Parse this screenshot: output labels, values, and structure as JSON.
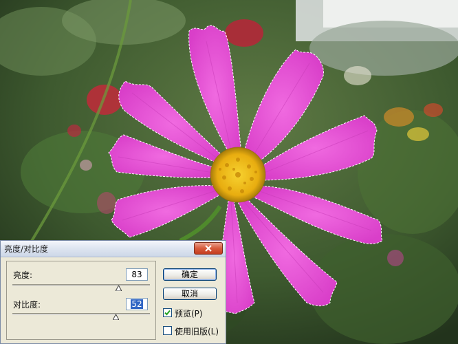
{
  "dialog": {
    "title": "亮度/对比度",
    "brightness": {
      "label": "亮度:",
      "value": "83",
      "level_percent": 75
    },
    "contrast": {
      "label": "对比度:",
      "value": "52",
      "level_percent": 73
    },
    "buttons": {
      "ok": "确定",
      "cancel": "取消"
    },
    "preview": {
      "label": "预览(P)",
      "checked": true
    },
    "legacy": {
      "label": "使用旧版(L)",
      "checked": false
    }
  },
  "icons": {
    "close": "close-icon",
    "checkmark": "checkmark-icon",
    "slider_thumb": "slider-thumb-icon"
  },
  "colors": {
    "petal": "#e64fd6",
    "flower_center": "#f4c21a",
    "dialog_bg": "#ece9d8",
    "close_button": "#d75b3c"
  }
}
